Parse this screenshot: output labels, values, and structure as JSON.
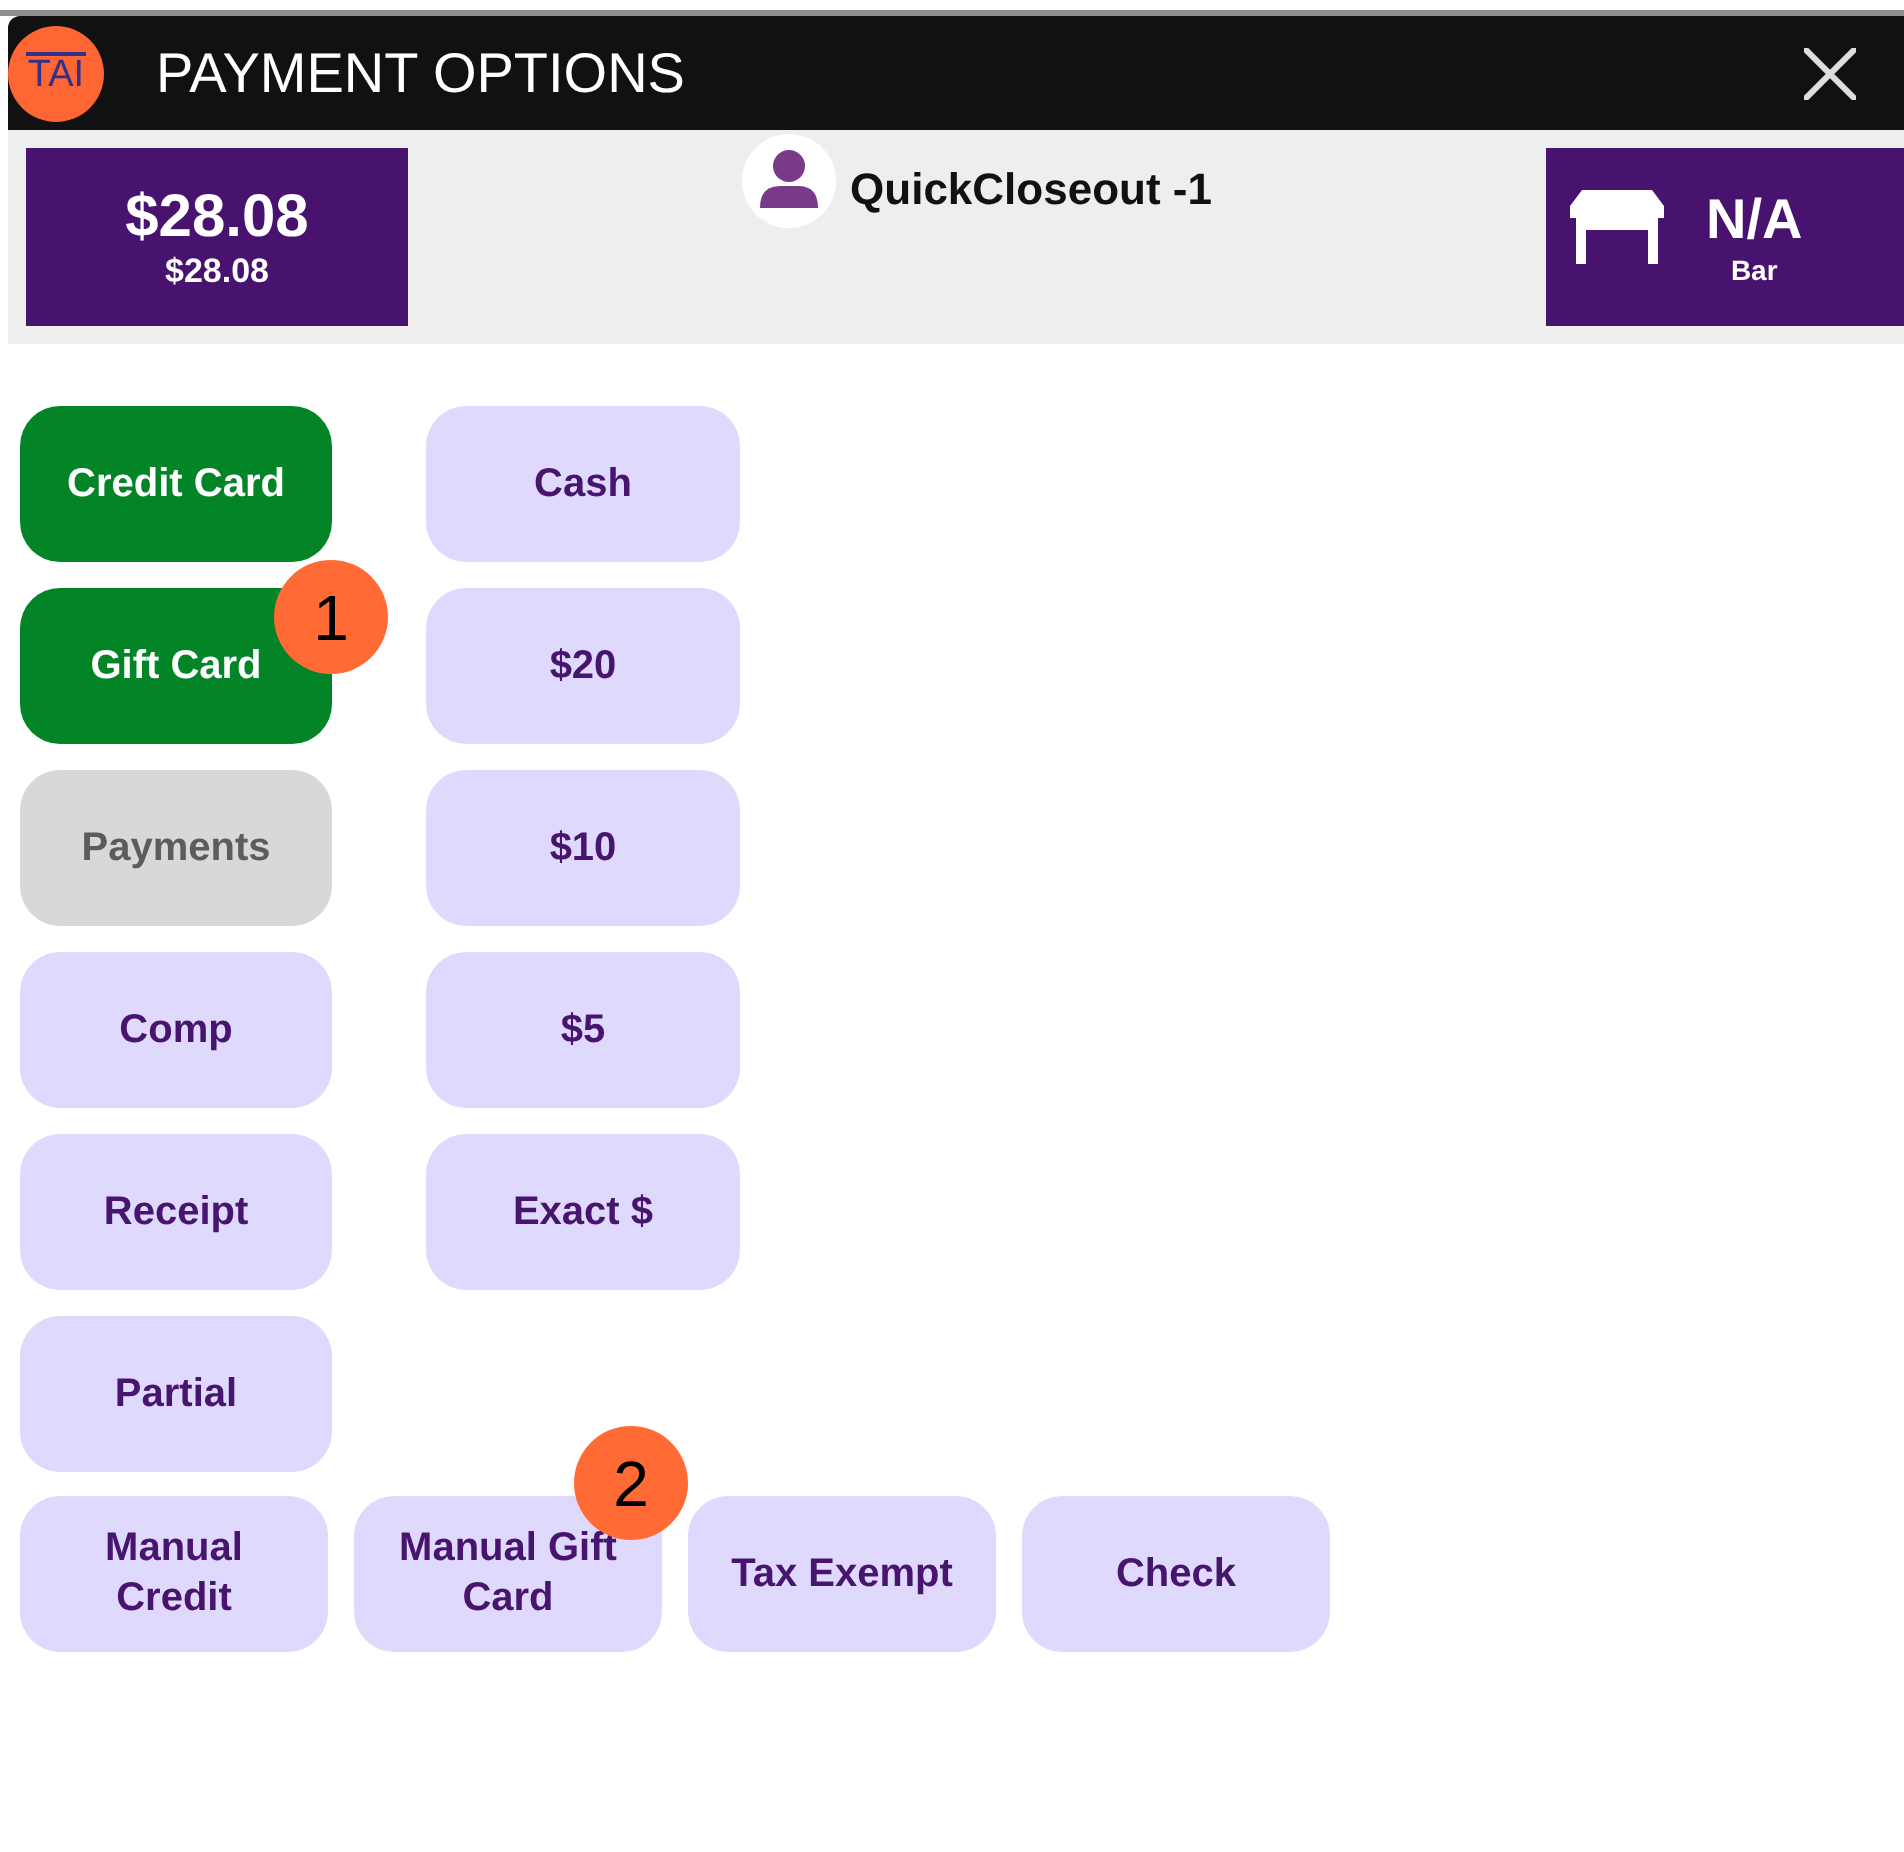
{
  "window": {
    "logo": "TAI",
    "title": "PAYMENT OPTIONS"
  },
  "order": {
    "total": "$28.08",
    "balance": "$28.08"
  },
  "customer": {
    "name": "QuickCloseout -1"
  },
  "table": {
    "name": "N/A",
    "area": "Bar"
  },
  "payment_buttons": {
    "columns": [
      [
        {
          "label": "Credit Card",
          "kind": "primary"
        },
        {
          "label": "Gift Card",
          "kind": "primary",
          "badge": "1"
        },
        {
          "label": "Payments",
          "kind": "inactive"
        },
        {
          "label": "Comp",
          "kind": "standard"
        },
        {
          "label": "Receipt",
          "kind": "standard"
        },
        {
          "label": "Partial",
          "kind": "standard"
        }
      ],
      [
        {
          "label": "Cash",
          "kind": "standard"
        },
        {
          "label": "$20",
          "kind": "standard"
        },
        {
          "label": "$10",
          "kind": "standard"
        },
        {
          "label": "$5",
          "kind": "standard"
        },
        {
          "label": "Exact $",
          "kind": "standard"
        }
      ]
    ],
    "bottom_row": [
      {
        "label": "Manual Credit",
        "kind": "standard"
      },
      {
        "label": "Manual Gift Card",
        "kind": "standard",
        "badge": "2"
      },
      {
        "label": "Tax Exempt",
        "kind": "standard"
      },
      {
        "label": "Check",
        "kind": "standard"
      }
    ]
  }
}
